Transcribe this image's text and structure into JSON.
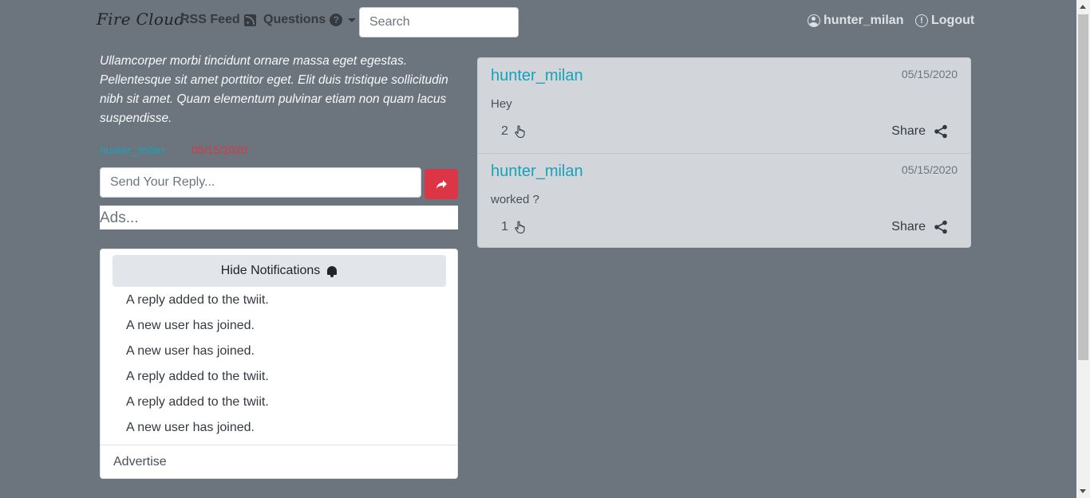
{
  "navbar": {
    "brand": "Fire Cloud",
    "rss_label": "RSS Feed",
    "questions_label": "Questions",
    "search_placeholder": "Search",
    "username": "hunter_milan",
    "logout_label": "Logout"
  },
  "post": {
    "body": "Ullamcorper morbi tincidunt ornare massa eget egestas. Pellentesque sit amet porttitor eget. Elit duis tristique sollicitudin nibh sit amet. Quam elementum pulvinar etiam non quam lacus suspendisse.",
    "author": "hunter_milan",
    "date": "05/15/2020"
  },
  "reply": {
    "placeholder": "Send Your Reply..."
  },
  "ads_label": "Ads...",
  "notifications": {
    "toggle_label": "Hide Notifications",
    "items": [
      "A reply added to the twiit.",
      "A new user has joined.",
      "A new user has joined.",
      "A reply added to the twiit.",
      "A reply added to the twiit.",
      "A new user has joined."
    ],
    "footer": "Advertise"
  },
  "tweets": [
    {
      "user": "hunter_milan",
      "date": "05/15/2020",
      "text": "Hey",
      "likes": "2",
      "share_label": "Share"
    },
    {
      "user": "hunter_milan",
      "date": "05/15/2020",
      "text": "worked ?",
      "likes": "1",
      "share_label": "Share"
    }
  ],
  "colors": {
    "background": "#6c757d",
    "accent_link": "#17a2b8",
    "danger": "#dc3545",
    "tweet_card": "#d2d6da"
  },
  "icons": {
    "rss": "rss-icon",
    "questions": "question-circle-icon",
    "user": "user-circle-icon",
    "logout": "info-circle-icon",
    "send": "share-arrow-icon",
    "bell": "bell-icon",
    "like": "hand-pointer-icon",
    "share": "share-alt-icon"
  }
}
